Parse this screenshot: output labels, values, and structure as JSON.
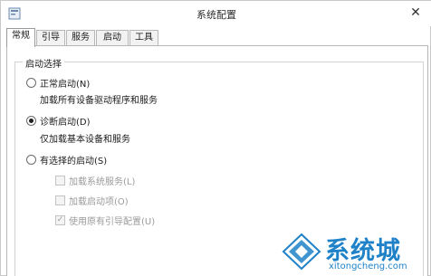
{
  "window": {
    "title": "系统配置"
  },
  "tabs": [
    {
      "label": "常规"
    },
    {
      "label": "引导"
    },
    {
      "label": "服务"
    },
    {
      "label": "启动"
    },
    {
      "label": "工具"
    }
  ],
  "group": {
    "title": "启动选择",
    "options": [
      {
        "label": "正常启动(N)",
        "desc": "加载所有设备驱动程序和服务",
        "checked": false
      },
      {
        "label": "诊断启动(D)",
        "desc": "仅加载基本设备和服务",
        "checked": true
      },
      {
        "label": "有选择的启动(S)",
        "checked": false
      }
    ],
    "selective_items": [
      {
        "label": "加载系统服务(L)",
        "checked": false
      },
      {
        "label": "加载启动项(O)",
        "checked": false
      },
      {
        "label": "使用原有引导配置(U)",
        "checked": true
      }
    ]
  },
  "watermark": {
    "text": "系统城",
    "url": "xitongcheng.com"
  },
  "colors": {
    "accent": "#1f82c8",
    "disabled_text": "#9b9b9b"
  }
}
